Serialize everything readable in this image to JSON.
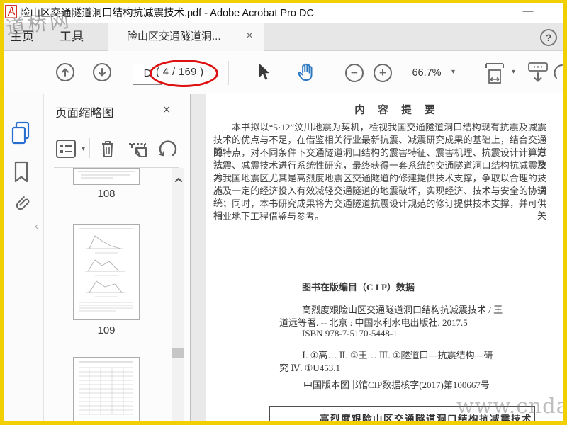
{
  "window": {
    "title": "险山区交通隧道洞口结构抗减震技术.pdf - Adobe Acrobat Pro DC",
    "minimize_glyph": "—"
  },
  "watermarks": {
    "top_left": "道桥网",
    "bottom_right": "www.cndao.com"
  },
  "tab_bar": {
    "home": "主页",
    "tools": "工具",
    "document_tab": "险山区交通隧道洞...",
    "close_glyph": "×",
    "help_glyph": "?"
  },
  "toolbar": {
    "page_label": "D",
    "page_count": "( 4 / 169 )",
    "zoom_value": "66.7%",
    "zoom_out_glyph": "−",
    "zoom_in_glyph": "+",
    "caret_glyph": "▾"
  },
  "sidebar": {
    "notch_glyph": "‹"
  },
  "thumbnail_panel": {
    "title": "页面缩略图",
    "close_glyph": "×",
    "page_labels": [
      "108",
      "109"
    ]
  },
  "document": {
    "abstract_heading": "内　容　提　要",
    "abstract_lines": [
      "本书拟以“5·12”汶川地震为契机，检视我国交通隧道洞口结构现有抗震及减震",
      "技术的优点与不足，在借鉴相关行业最新抗震、减震研究成果的基础上，结合交通隧道",
      "的特点，对不同条件下交通隧道洞口结构的震害特征、震害机理、抗震设计计算方法及",
      "抗震、减震技术进行系统性研究，最终获得一套系统的交通隧道洞口结构抗减震技术，",
      "为我国地震区尤其是高烈度地震区交通隧道的修建提供技术支撑，争取以合理的技术措",
      "施及一定的经济投入有效减轻交通隧道的地震破坏，实现经济、技术与安全的协调统",
      "一；同时，本书研究成果将为交通隧道抗震设计规范的修订提供技术支撑，并可供相关",
      "行业地下工程借鉴与参考。"
    ],
    "cip_heading": "图书在版编目（C I P）数据",
    "cip_lines": [
      "高烈度艰险山区交通隧道洞口结构抗减震技术 / 王",
      "道远等著. -- 北京 : 中国水利水电出版社, 2017.5",
      "ISBN 978-7-5170-5448-1",
      "Ⅰ. ①高… Ⅱ. ①王… Ⅲ. ①隧道口—抗震结构—研",
      "究 Ⅳ. ①U453.1"
    ],
    "cip_register": "中国版本图书馆CIP数据核字(2017)第100667号",
    "footer_box_title": "高烈度艰险山区交通隧道洞口结构抗减震技术"
  },
  "colors": {
    "frame_yellow": "#f2cf00",
    "annotation_red": "#dd1111",
    "active_icon_blue": "#2a6fd0",
    "hand_tool_blue": "#2e78c2"
  }
}
